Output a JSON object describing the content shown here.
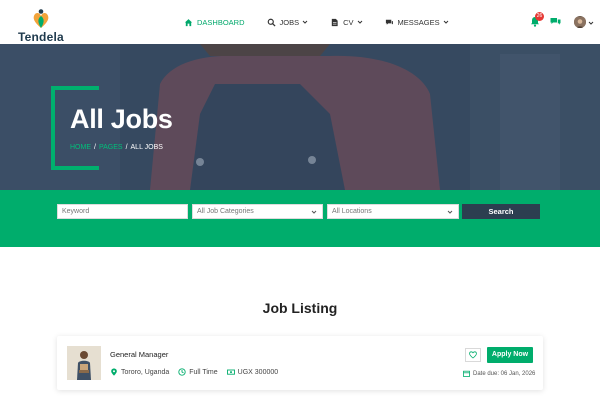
{
  "brand": {
    "name": "Tendela",
    "accent": "#00ad6c",
    "dark": "#2c3e50"
  },
  "nav": {
    "items": [
      {
        "label": "DASHBOARD",
        "icon": "home-icon",
        "active": true
      },
      {
        "label": "JOBS",
        "icon": "search-icon",
        "active": false
      },
      {
        "label": "CV",
        "icon": "document-icon",
        "active": false
      },
      {
        "label": "MESSAGES",
        "icon": "chat-icon",
        "active": false
      }
    ],
    "notifications_count": "26"
  },
  "hero": {
    "title": "All Jobs",
    "breadcrumb": {
      "home": "HOME",
      "pages": "PAGES",
      "current": "ALL JOBS",
      "separator": "/"
    }
  },
  "search": {
    "keyword_placeholder": "Keyword",
    "category_value": "All Job Categories",
    "location_value": "All Locations",
    "button_label": "Search"
  },
  "listing": {
    "title": "Job Listing",
    "jobs": [
      {
        "title": "General Manager",
        "location": "Tororo, Uganda",
        "type": "Full Time",
        "salary": "UGX 300000",
        "apply_label": "Apply Now",
        "due": "Date due: 06 Jan, 2026"
      }
    ]
  }
}
